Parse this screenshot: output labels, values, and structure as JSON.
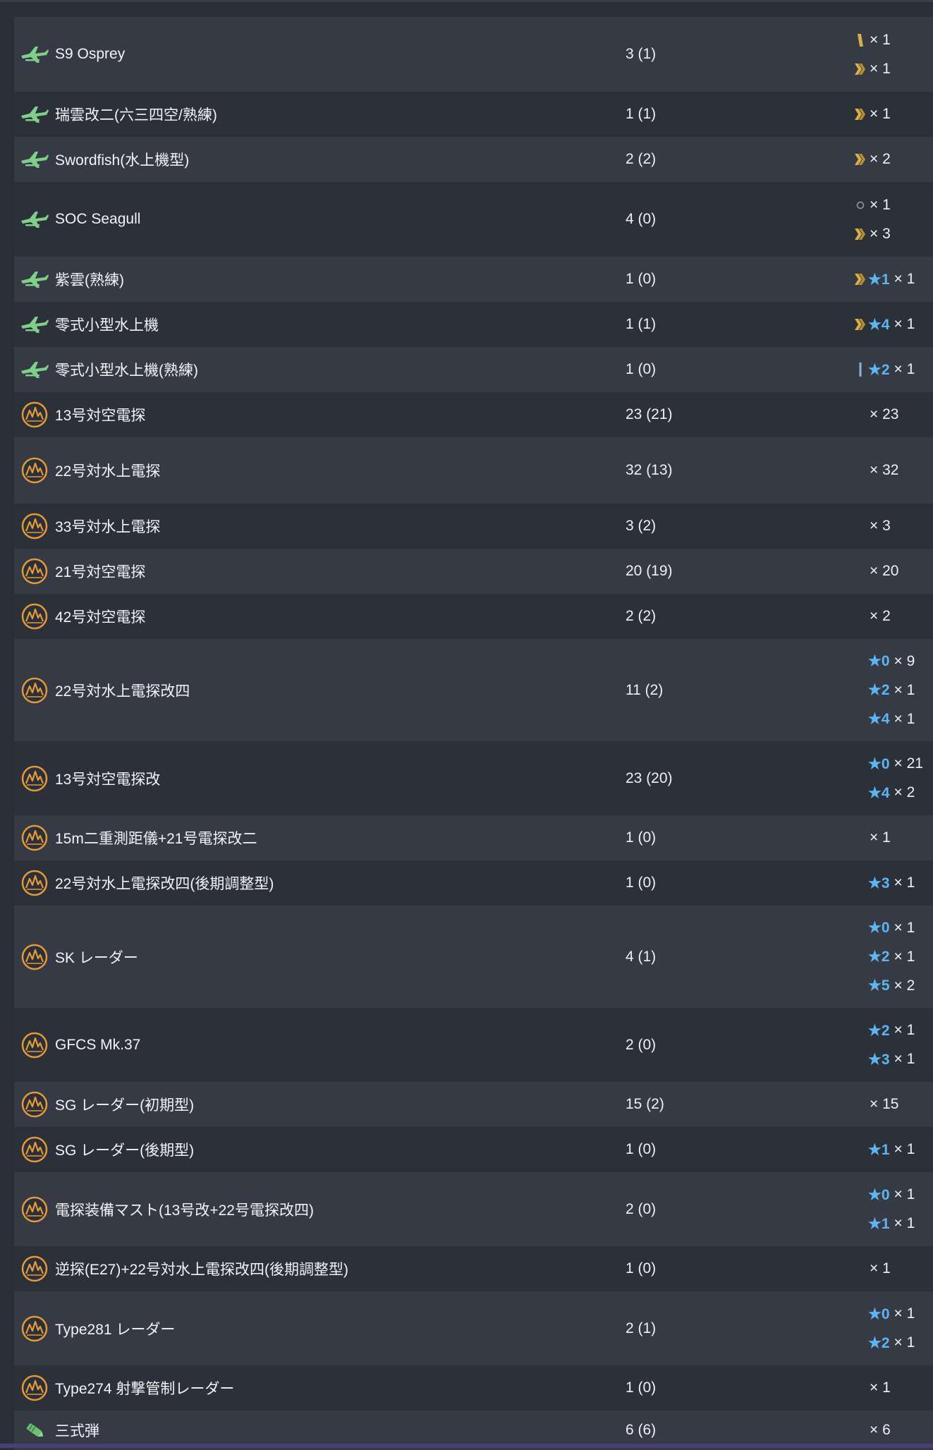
{
  "rows": [
    {
      "name": "S9 Osprey",
      "count": "3 (1)",
      "icon": "seaplane-icon",
      "h": 106,
      "levels": [
        {
          "prof": "prof-1",
          "star": "",
          "mult": "× 1"
        },
        {
          "prof": "prof-2",
          "star": "",
          "mult": "× 1"
        }
      ]
    },
    {
      "name": "瑞雲改二(六三四空/熟練)",
      "count": "1 (1)",
      "icon": "seaplane-icon",
      "h": 64,
      "levels": [
        {
          "prof": "prof-2",
          "star": "",
          "mult": "× 1"
        }
      ]
    },
    {
      "name": "Swordfish(水上機型)",
      "count": "2 (2)",
      "icon": "seaplane-icon",
      "h": 64,
      "levels": [
        {
          "prof": "prof-2",
          "star": "",
          "mult": "× 2"
        }
      ]
    },
    {
      "name": "SOC Seagull",
      "count": "4 (0)",
      "icon": "seaplane-icon",
      "h": 106,
      "levels": [
        {
          "prof": "prof-0",
          "star": "",
          "mult": "× 1"
        },
        {
          "prof": "prof-2",
          "star": "",
          "mult": "× 3"
        }
      ]
    },
    {
      "name": "紫雲(熟練)",
      "count": "1 (0)",
      "icon": "seaplane-icon",
      "h": 64,
      "levels": [
        {
          "prof": "prof-2",
          "star": "★1",
          "mult": "× 1"
        }
      ]
    },
    {
      "name": "零式小型水上機",
      "count": "1 (1)",
      "icon": "seaplane-icon",
      "h": 64,
      "levels": [
        {
          "prof": "prof-2",
          "star": "★4",
          "mult": "× 1"
        }
      ]
    },
    {
      "name": "零式小型水上機(熟練)",
      "count": "1 (0)",
      "icon": "seaplane-icon",
      "h": 64,
      "levels": [
        {
          "prof": "prof-1b",
          "star": "★2",
          "mult": "× 1"
        }
      ]
    },
    {
      "name": "13号対空電探",
      "count": "23 (21)",
      "icon": "radar-icon",
      "h": 64,
      "levels": [
        {
          "prof": "",
          "star": "",
          "mult": "× 23"
        }
      ]
    },
    {
      "name": "22号対水上電探",
      "count": "32 (13)",
      "icon": "radar-icon",
      "h": 94,
      "levels": [
        {
          "prof": "",
          "star": "",
          "mult": "× 32"
        }
      ]
    },
    {
      "name": "33号対水上電探",
      "count": "3 (2)",
      "icon": "radar-icon",
      "h": 64,
      "levels": [
        {
          "prof": "",
          "star": "",
          "mult": "× 3"
        }
      ]
    },
    {
      "name": "21号対空電探",
      "count": "20 (19)",
      "icon": "radar-icon",
      "h": 64,
      "levels": [
        {
          "prof": "",
          "star": "",
          "mult": "× 20"
        }
      ]
    },
    {
      "name": "42号対空電探",
      "count": "2 (2)",
      "icon": "radar-icon",
      "h": 64,
      "levels": [
        {
          "prof": "",
          "star": "",
          "mult": "× 2"
        }
      ]
    },
    {
      "name": "22号対水上電探改四",
      "count": "11 (2)",
      "icon": "radar-icon",
      "h": 145,
      "levels": [
        {
          "prof": "",
          "star": "★0",
          "mult": "× 9"
        },
        {
          "prof": "",
          "star": "★2",
          "mult": "× 1"
        },
        {
          "prof": "",
          "star": "★4",
          "mult": "× 1"
        }
      ]
    },
    {
      "name": "13号対空電探改",
      "count": "23 (20)",
      "icon": "radar-icon",
      "h": 105,
      "levels": [
        {
          "prof": "",
          "star": "★0",
          "mult": "× 21"
        },
        {
          "prof": "",
          "star": "★4",
          "mult": "× 2"
        }
      ]
    },
    {
      "name": "15m二重測距儀+21号電探改二",
      "count": "1 (0)",
      "icon": "radar-icon",
      "h": 64,
      "levels": [
        {
          "prof": "",
          "star": "",
          "mult": "× 1"
        }
      ]
    },
    {
      "name": "22号対水上電探改四(後期調整型)",
      "count": "1 (0)",
      "icon": "radar-icon",
      "h": 64,
      "levels": [
        {
          "prof": "",
          "star": "★3",
          "mult": "× 1"
        }
      ]
    },
    {
      "name": "SK レーダー",
      "count": "4 (1)",
      "icon": "radar-icon",
      "h": 145,
      "levels": [
        {
          "prof": "",
          "star": "★0",
          "mult": "× 1"
        },
        {
          "prof": "",
          "star": "★2",
          "mult": "× 1"
        },
        {
          "prof": "",
          "star": "★5",
          "mult": "× 2"
        }
      ]
    },
    {
      "name": "GFCS Mk.37",
      "count": "2 (0)",
      "icon": "radar-icon",
      "h": 105,
      "levels": [
        {
          "prof": "",
          "star": "★2",
          "mult": "× 1"
        },
        {
          "prof": "",
          "star": "★3",
          "mult": "× 1"
        }
      ]
    },
    {
      "name": "SG レーダー(初期型)",
      "count": "15 (2)",
      "icon": "radar-icon",
      "h": 64,
      "levels": [
        {
          "prof": "",
          "star": "",
          "mult": "× 15"
        }
      ]
    },
    {
      "name": "SG レーダー(後期型)",
      "count": "1 (0)",
      "icon": "radar-icon",
      "h": 64,
      "levels": [
        {
          "prof": "",
          "star": "★1",
          "mult": "× 1"
        }
      ]
    },
    {
      "name": "電探装備マスト(13号改+22号電探改四)",
      "count": "2 (0)",
      "icon": "radar-icon",
      "h": 105,
      "levels": [
        {
          "prof": "",
          "star": "★0",
          "mult": "× 1"
        },
        {
          "prof": "",
          "star": "★1",
          "mult": "× 1"
        }
      ]
    },
    {
      "name": "逆探(E27)+22号対水上電探改四(後期調整型)",
      "count": "1 (0)",
      "icon": "radar-icon",
      "h": 64,
      "levels": [
        {
          "prof": "",
          "star": "",
          "mult": "× 1"
        }
      ]
    },
    {
      "name": "Type281 レーダー",
      "count": "2 (1)",
      "icon": "radar-icon",
      "h": 105,
      "levels": [
        {
          "prof": "",
          "star": "★0",
          "mult": "× 1"
        },
        {
          "prof": "",
          "star": "★2",
          "mult": "× 1"
        }
      ]
    },
    {
      "name": "Type274 射撃管制レーダー",
      "count": "1 (0)",
      "icon": "radar-icon",
      "h": 64,
      "levels": [
        {
          "prof": "",
          "star": "",
          "mult": "× 1"
        }
      ]
    },
    {
      "name": "三式弾",
      "count": "6 (6)",
      "icon": "shell-icon",
      "h": 56,
      "levels": [
        {
          "prof": "",
          "star": "",
          "mult": "× 6"
        }
      ]
    }
  ],
  "colors": {
    "star": "#5db5f2",
    "seaplane": "#7fcf8a",
    "radar": "#e49a3a",
    "shell": "#6fbf72",
    "prof": "#d9ad4a",
    "prof_low": "#8fb4d8"
  }
}
